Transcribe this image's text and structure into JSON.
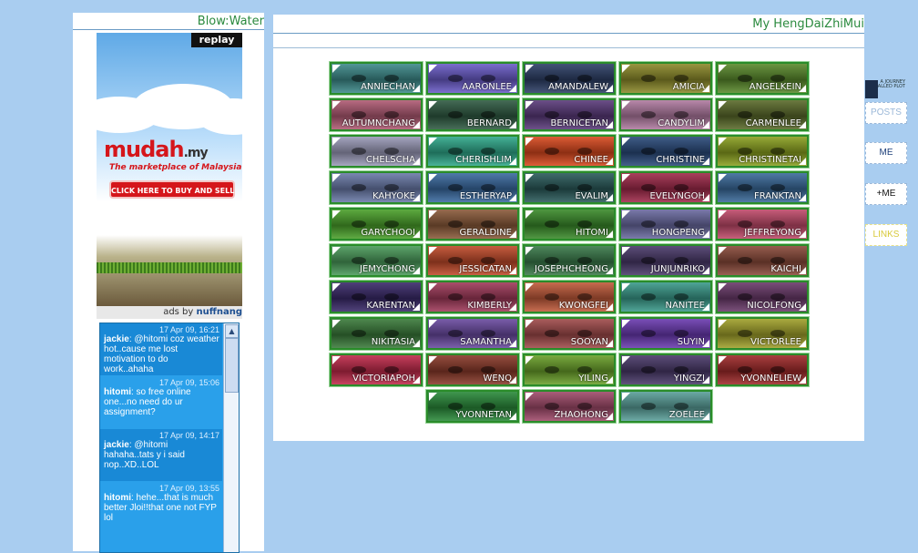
{
  "left": {
    "title": "Blow:Water",
    "ad": {
      "replay": "replay",
      "brand": "mudah",
      "brand_suffix": ".my",
      "tagline": "The marketplace of Malaysia",
      "cta": "CLICK HERE TO BUY AND SELL",
      "ads_by": "ads by",
      "ads_network": "nuffnang"
    },
    "chat": [
      {
        "time": "17 Apr 09, 16:21",
        "user": "jackie",
        "text": ": @hitomi coz weather hot..cause me lost motivation to do work..ahaha"
      },
      {
        "time": "17 Apr 09, 15:06",
        "user": "hitomi",
        "text": ": so free online one...no need do ur assignment?"
      },
      {
        "time": "17 Apr 09, 14:17",
        "user": "jackie",
        "text": ": @hitomi hahaha..tats y i said nop..XD..LOL"
      },
      {
        "time": "17 Apr 09, 13:55",
        "user": "hitomi",
        "text": ": hehe...that is much better Jloi!!that one not FYP lol"
      }
    ]
  },
  "main": {
    "title": "My HengDaiZhiMui",
    "friends": [
      {
        "name": "ANNIECHAN",
        "color": "#3d8a8a"
      },
      {
        "name": "AARONLEE",
        "color": "#6a5cc8"
      },
      {
        "name": "AMANDALEW",
        "color": "#2d3f66"
      },
      {
        "name": "AMICIA",
        "color": "#8c8a2a"
      },
      {
        "name": "ANGELKEIN",
        "color": "#5a8a2c"
      },
      {
        "name": "AUTUMNCHANG",
        "color": "#b05a73"
      },
      {
        "name": "BERNARD",
        "color": "#2f5a42"
      },
      {
        "name": "BERNICETAN",
        "color": "#5a3a7a"
      },
      {
        "name": "CANDYLIM",
        "color": "#b07aa0"
      },
      {
        "name": "CARMENLEE",
        "color": "#5a6a2a"
      },
      {
        "name": "CHELSCHA",
        "color": "#9a9ab8"
      },
      {
        "name": "CHERISHLIM",
        "color": "#2fa88a"
      },
      {
        "name": "CHINEE",
        "color": "#d8481e"
      },
      {
        "name": "CHRISTINE",
        "color": "#2a4a7a"
      },
      {
        "name": "CHRISTINETAI",
        "color": "#8aa020"
      },
      {
        "name": "KAHYOKE",
        "color": "#6a7aa8"
      },
      {
        "name": "ESTHERYAP",
        "color": "#3a6aa0"
      },
      {
        "name": "EVALIM",
        "color": "#2a5a5a"
      },
      {
        "name": "EVELYNGOH",
        "color": "#a02a4a"
      },
      {
        "name": "FRANKTAN",
        "color": "#3a6a9a"
      },
      {
        "name": "GARYCHOOI",
        "color": "#4aa02a"
      },
      {
        "name": "GERALDINE",
        "color": "#8a5a3a"
      },
      {
        "name": "HITOMI",
        "color": "#3a8a2a"
      },
      {
        "name": "HONGPENG",
        "color": "#6a6aa0"
      },
      {
        "name": "JEFFREYONG",
        "color": "#c04a6a"
      },
      {
        "name": "JEMYCHONG",
        "color": "#4a9a5a"
      },
      {
        "name": "JESSICATAN",
        "color": "#c04a2a"
      },
      {
        "name": "JOSEPHCHEONG",
        "color": "#3a7a4a"
      },
      {
        "name": "JUNJUNRIKO",
        "color": "#4a3a6a"
      },
      {
        "name": "KAICHI",
        "color": "#8a4a3a"
      },
      {
        "name": "KARENTAN",
        "color": "#3a2a6a"
      },
      {
        "name": "KIMBERLY",
        "color": "#a03a5a"
      },
      {
        "name": "KWONGFEI",
        "color": "#c05a3a"
      },
      {
        "name": "NANITEE",
        "color": "#3a9a8a"
      },
      {
        "name": "NICOLFONG",
        "color": "#6a3a6a"
      },
      {
        "name": "NIKITASIA",
        "color": "#3a7a3a"
      },
      {
        "name": "SAMANTHA",
        "color": "#6a4aa0"
      },
      {
        "name": "SOOYAN",
        "color": "#a04a4a"
      },
      {
        "name": "SUYIN",
        "color": "#6a3ab0"
      },
      {
        "name": "VICTORLEE",
        "color": "#a0a02a"
      },
      {
        "name": "VICTORIAPOH",
        "color": "#c02a4a"
      },
      {
        "name": "WENQ",
        "color": "#8a3a2a"
      },
      {
        "name": "YILING",
        "color": "#6aa02a"
      },
      {
        "name": "YINGZI",
        "color": "#4a3a6a"
      },
      {
        "name": "YVONNELIEW",
        "color": "#a02a2a"
      },
      {
        "name": "YVONNETAN",
        "color": "#2a8a3a"
      },
      {
        "name": "ZHAOHONG",
        "color": "#a04a6a"
      },
      {
        "name": "ZOELEE",
        "color": "#5aa09a"
      }
    ]
  },
  "nav": {
    "badge": "A JOURNEY CALLED PLOT",
    "posts": "POSTS",
    "me": "ME",
    "plus_me": "+ME",
    "links": "LINKS"
  }
}
